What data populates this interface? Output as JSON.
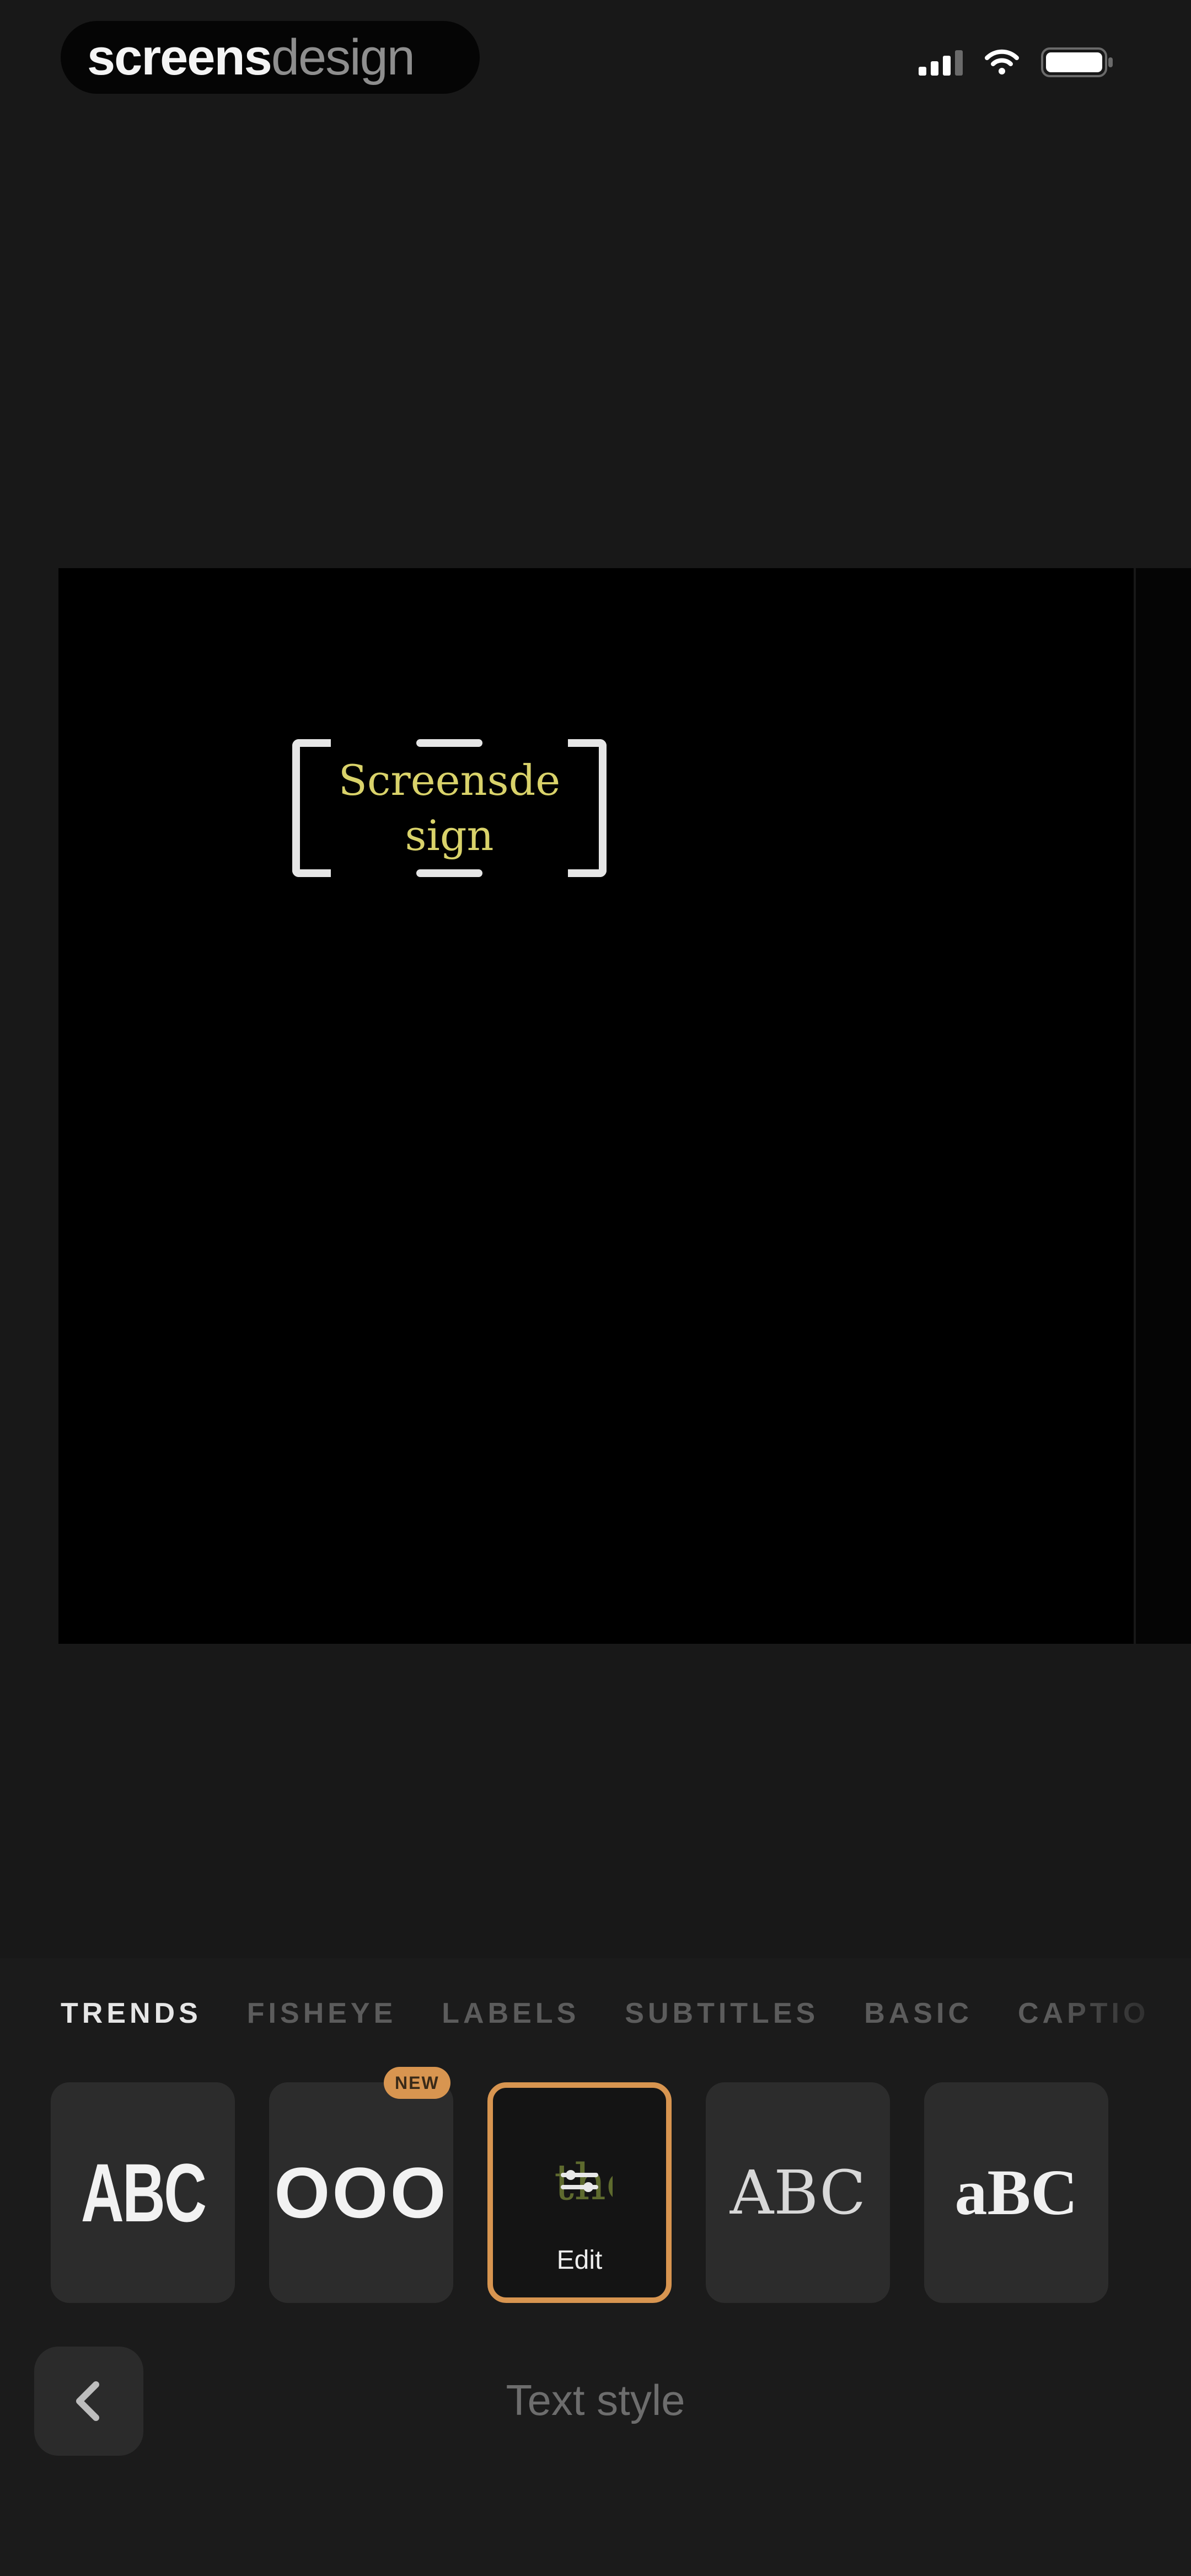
{
  "status_bar": {
    "brand_primary": "screens",
    "brand_secondary": "design",
    "icons": [
      "cellular-signal-icon",
      "wifi-icon",
      "battery-icon"
    ]
  },
  "canvas": {
    "caption_text": "Screensdesign",
    "caption_color": "#d9d26a"
  },
  "style_tabs": {
    "items": [
      "TRENDS",
      "FISHEYE",
      "LABELS",
      "SUBTITLES",
      "BASIC",
      "CAPTIO"
    ],
    "active": "TRENDS"
  },
  "style_cards": [
    {
      "label": "ABC",
      "type": "condensed"
    },
    {
      "label": "OOO",
      "type": "circles",
      "badge": "NEW"
    },
    {
      "label": "Edit",
      "type": "selected-edit"
    },
    {
      "label": "ABC",
      "type": "serif"
    },
    {
      "label": "aBC",
      "type": "bold-serif"
    }
  ],
  "bottom_bar": {
    "title": "Text style",
    "back_icon": "chevron-left-icon"
  },
  "colors": {
    "background": "#181818",
    "panel": "#1b1b1b",
    "card": "#2c2c2c",
    "accent": "#d89550"
  }
}
